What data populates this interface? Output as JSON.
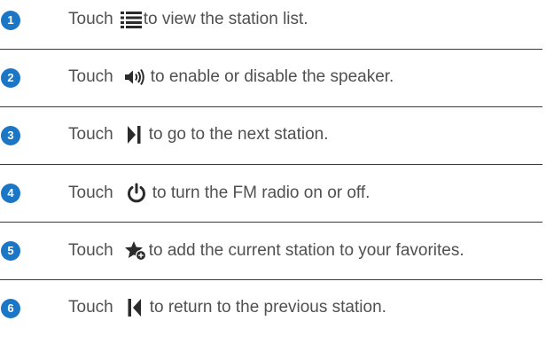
{
  "accent_color": "#1c76c6",
  "steps": [
    {
      "number": "1",
      "prefix": "Touch",
      "icon": "list-icon",
      "text": "to view the station list."
    },
    {
      "number": "2",
      "prefix": "Touch",
      "icon": "speaker-icon",
      "text": "to enable or disable the speaker."
    },
    {
      "number": "3",
      "prefix": "Touch",
      "icon": "next-station-icon",
      "text": "to go to the next station."
    },
    {
      "number": "4",
      "prefix": "Touch",
      "icon": "power-icon",
      "text": "to turn the FM radio on or off."
    },
    {
      "number": "5",
      "prefix": "Touch",
      "icon": "add-favorite-icon",
      "text": "to add the current station to your favorites."
    },
    {
      "number": "6",
      "prefix": "Touch",
      "icon": "previous-station-icon",
      "text": "to return to the previous station."
    }
  ]
}
